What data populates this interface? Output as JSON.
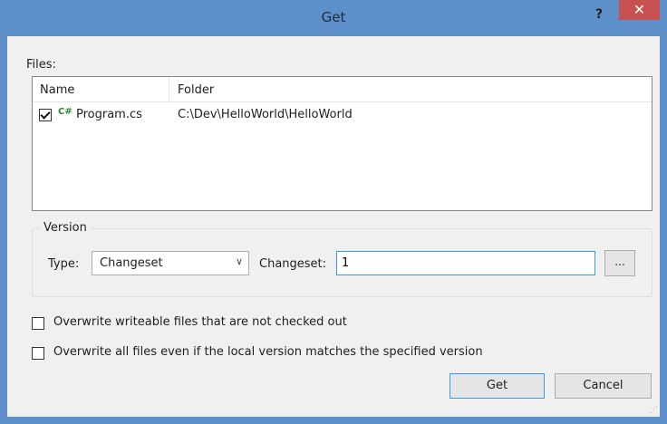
{
  "window": {
    "title": "Get",
    "help_label": "?",
    "close_label": "✕"
  },
  "files": {
    "label": "Files:",
    "columns": [
      "Name",
      "Folder"
    ],
    "rows": [
      {
        "checked": true,
        "icon": "C#",
        "name": "Program.cs",
        "folder": "C:\\Dev\\HelloWorld\\HelloWorld"
      }
    ]
  },
  "version": {
    "group_label": "Version",
    "type_label": "Type:",
    "type_value": "Changeset",
    "changeset_label": "Changeset:",
    "changeset_value": "1",
    "browse_label": "..."
  },
  "options": {
    "overwrite_writeable": "Overwrite writeable files that are not checked out",
    "overwrite_all": "Overwrite all files even if the local version matches the specified version"
  },
  "buttons": {
    "get": "Get",
    "cancel": "Cancel"
  },
  "colors": {
    "titlebar": "#5d8fc9",
    "close": "#c75050",
    "focus_border": "#3399ff"
  }
}
